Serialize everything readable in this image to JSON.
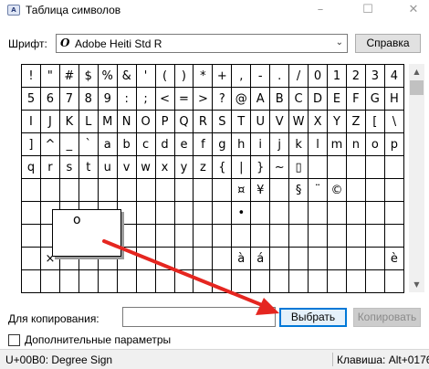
{
  "window": {
    "icon_text": "A",
    "title": "Таблица символов",
    "minimize_glyph": "–",
    "maximize_glyph": "☐",
    "close_glyph": "✕"
  },
  "font_row": {
    "label": "Шрифт:",
    "font_glyph": "O",
    "font_name": "Adobe Heiti Std R",
    "arrow_glyph": "⌄",
    "help_button": "Справка"
  },
  "grid": {
    "rows": [
      [
        "!",
        "\"",
        "#",
        "$",
        "%",
        "&",
        "'",
        "(",
        ")",
        "*",
        "+",
        ",",
        "-",
        ".",
        "/",
        "0",
        "1",
        "2",
        "3",
        "4"
      ],
      [
        "5",
        "6",
        "7",
        "8",
        "9",
        ":",
        ";",
        "<",
        "=",
        ">",
        "?",
        "@",
        "A",
        "B",
        "C",
        "D",
        "E",
        "F",
        "G",
        "H"
      ],
      [
        "I",
        "J",
        "K",
        "L",
        "M",
        "N",
        "O",
        "P",
        "Q",
        "R",
        "S",
        "T",
        "U",
        "V",
        "W",
        "X",
        "Y",
        "Z",
        "[",
        "\\"
      ],
      [
        "]",
        "^",
        "_",
        "`",
        "a",
        "b",
        "c",
        "d",
        "e",
        "f",
        "g",
        "h",
        "i",
        "j",
        "k",
        "l",
        "m",
        "n",
        "o",
        "p"
      ],
      [
        "q",
        "r",
        "s",
        "t",
        "u",
        "v",
        "w",
        "x",
        "y",
        "z",
        "{",
        "|",
        "}",
        "~",
        "▯",
        "",
        "",
        "",
        "",
        ""
      ],
      [
        "",
        "",
        "",
        "",
        "",
        "",
        "",
        "",
        "",
        "",
        "",
        "¤",
        "¥",
        "",
        "§",
        "¨",
        "©",
        "",
        "",
        ""
      ],
      [
        "",
        "",
        "",
        "",
        "",
        "",
        "",
        "",
        "",
        "",
        "",
        "•",
        "",
        "",
        "",
        "",
        "",
        "",
        "",
        ""
      ],
      [
        "",
        "",
        "",
        "",
        "",
        "",
        "",
        "",
        "",
        "",
        "",
        "",
        "",
        "",
        "",
        "",
        "",
        "",
        "",
        ""
      ],
      [
        "",
        "×",
        "",
        "",
        "",
        "",
        "",
        "",
        "",
        "",
        "",
        "à",
        "á",
        "",
        "",
        "",
        "",
        "",
        "",
        "è"
      ],
      [
        "",
        "",
        "",
        "",
        "",
        "",
        "",
        "",
        "",
        "",
        "",
        "",
        "",
        "",
        "",
        "",
        "",
        "",
        "",
        ""
      ]
    ],
    "zoomed_char": "o"
  },
  "scrollbar": {
    "up_glyph": "▲",
    "down_glyph": "▼"
  },
  "copy_row": {
    "label": "Для копирования:",
    "input_value": "",
    "select_button": "Выбрать",
    "copy_button": "Копировать"
  },
  "advanced": {
    "label": "Дополнительные параметры",
    "checked": false
  },
  "status": {
    "char_info": "U+00B0: Degree Sign",
    "keystroke": "Клавиша: Alt+0176"
  },
  "colors": {
    "arrow": "#e52620",
    "primary_button_border": "#0078d7"
  }
}
